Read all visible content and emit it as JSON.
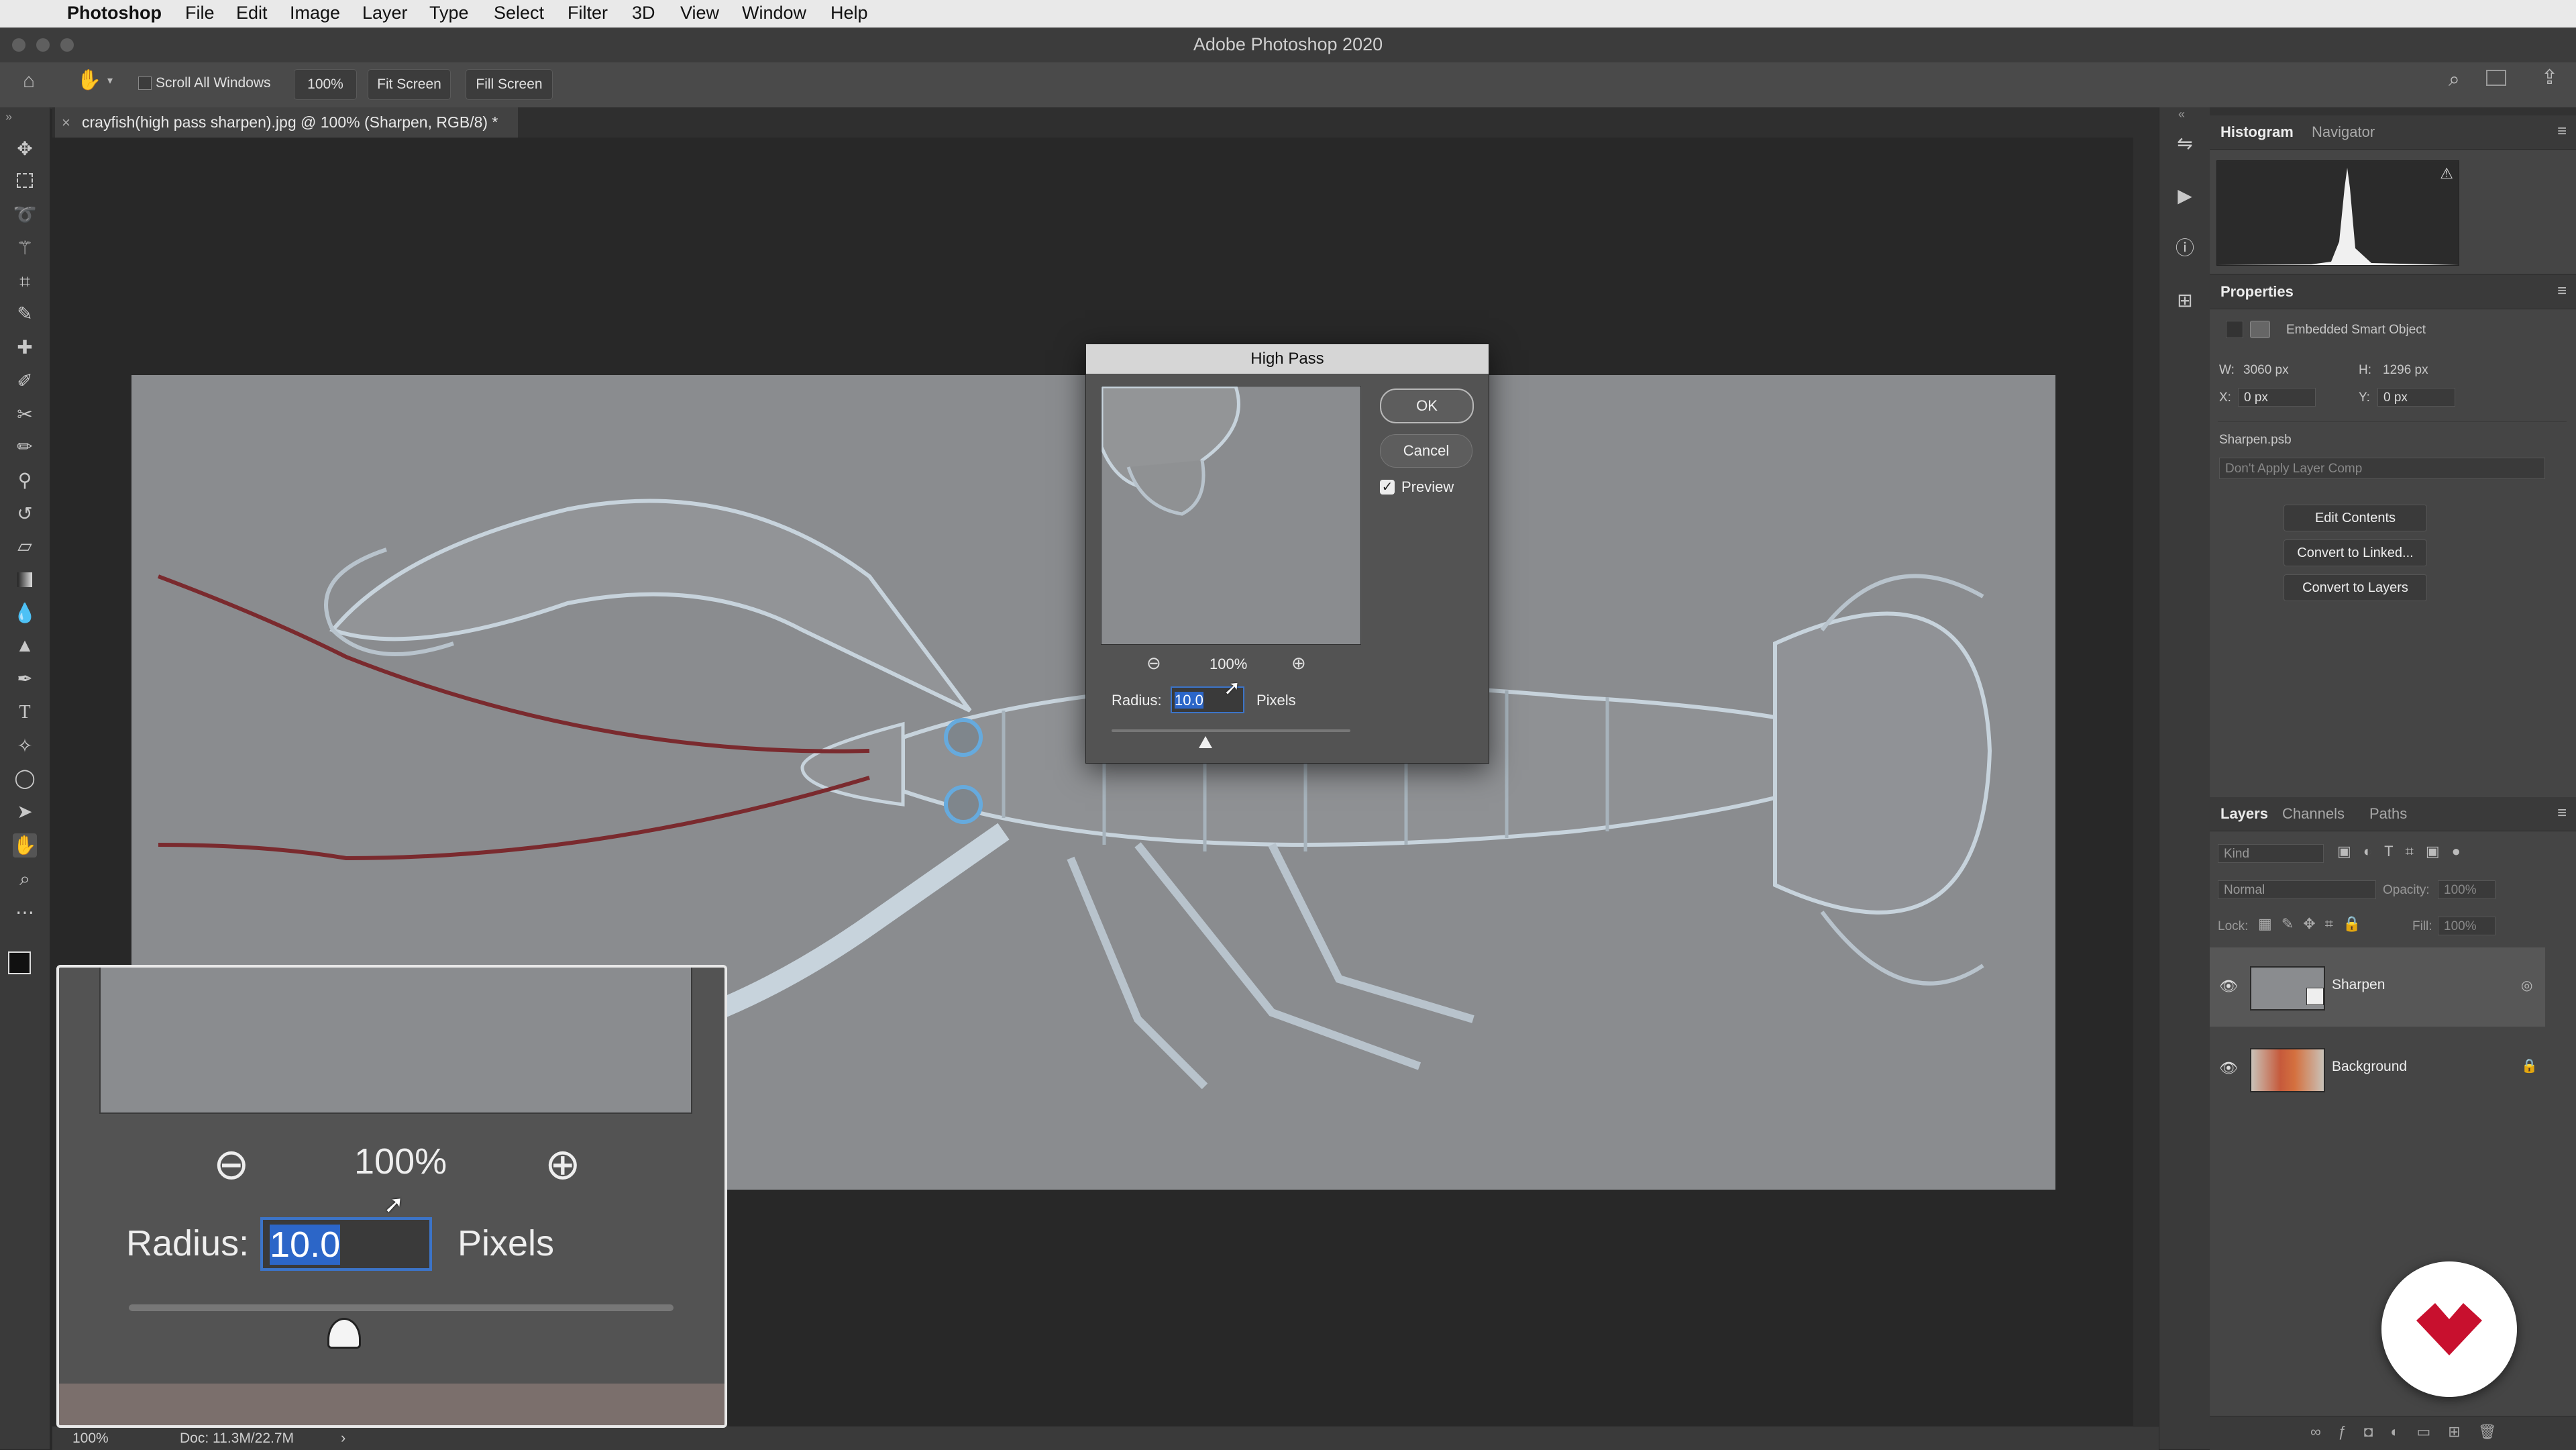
{
  "menubar": {
    "app": "Photoshop",
    "items": [
      "File",
      "Edit",
      "Image",
      "Layer",
      "Type",
      "Select",
      "Filter",
      "3D",
      "View",
      "Window",
      "Help"
    ]
  },
  "window": {
    "title": "Adobe Photoshop 2020"
  },
  "options": {
    "scroll_all_windows": "Scroll All Windows",
    "zoom": "100%",
    "fit_screen": "Fit Screen",
    "fill_screen": "Fill Screen"
  },
  "document": {
    "tab_title": "crayfish(high pass sharpen).jpg @ 100% (Sharpen, RGB/8) *",
    "status_zoom": "100%",
    "doc_size": "Doc: 11.3M/22.7M"
  },
  "panels": {
    "histogram": {
      "tabs": [
        "Histogram",
        "Navigator"
      ]
    },
    "properties": {
      "title": "Properties",
      "type": "Embedded Smart Object",
      "w_label": "W:",
      "w_value": "3060 px",
      "h_label": "H:",
      "h_value": "1296 px",
      "x_label": "X:",
      "x_value": "0 px",
      "y_label": "Y:",
      "y_value": "0 px",
      "filename": "Sharpen.psb",
      "layer_comp": "Don't Apply Layer Comp",
      "buttons": [
        "Edit Contents",
        "Convert to Linked...",
        "Convert to Layers"
      ]
    },
    "layers": {
      "tabs": [
        "Layers",
        "Channels",
        "Paths"
      ],
      "filter_kind": "Kind",
      "blend_mode": "Normal",
      "opacity_label": "Opacity:",
      "opacity_value": "100%",
      "lock_label": "Lock:",
      "fill_label": "Fill:",
      "fill_value": "100%",
      "items": [
        {
          "name": "Sharpen"
        },
        {
          "name": "Background"
        }
      ]
    }
  },
  "dialog": {
    "title": "High Pass",
    "ok": "OK",
    "cancel": "Cancel",
    "preview_label": "Preview",
    "preview_checked": true,
    "zoom": "100%",
    "radius_label": "Radius:",
    "radius_value": "10.0",
    "unit": "Pixels"
  },
  "callout": {
    "zoom": "100%",
    "radius_label": "Radius:",
    "radius_value": "10.0",
    "unit": "Pixels"
  },
  "colors": {
    "accent": "#2c66c8",
    "logo_red": "#c8102e",
    "panel_bg": "#454545"
  }
}
